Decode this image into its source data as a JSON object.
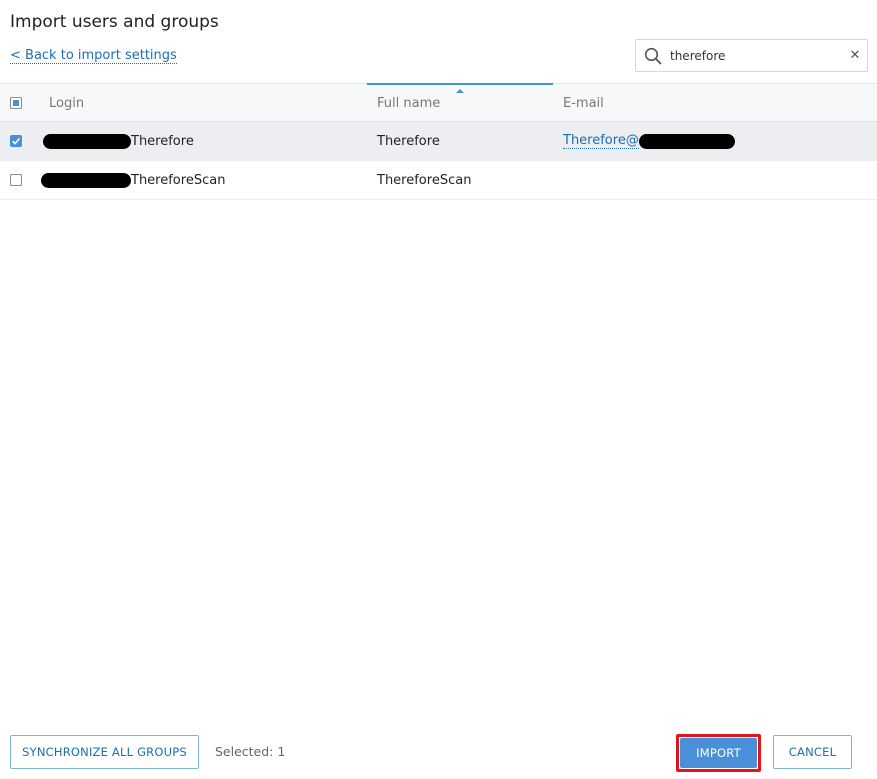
{
  "header": {
    "title": "Import users and groups",
    "back_link": "< Back to import settings"
  },
  "search": {
    "value": "therefore",
    "placeholder": ""
  },
  "table": {
    "columns": {
      "login": "Login",
      "full_name": "Full name",
      "email": "E-mail"
    },
    "sort_column": "Full name",
    "rows": [
      {
        "login_suffix": "Therefore",
        "full_name": "Therefore",
        "email_prefix": "Therefore@",
        "checked": true
      },
      {
        "login_suffix": "ThereforeScan",
        "full_name": "ThereforeScan",
        "email_prefix": "",
        "checked": false
      }
    ]
  },
  "footer": {
    "sync_label": "SYNCHRONIZE ALL GROUPS",
    "selected_label": "Selected: 1",
    "import_label": "IMPORT",
    "cancel_label": "CANCEL"
  },
  "colors": {
    "accent": "#4a90d9",
    "link": "#1a6fb5",
    "highlight": "#e0161f",
    "selected_row": "#eceef1"
  },
  "icons": {
    "search": "search-icon",
    "clear": "close-icon",
    "check": "check-icon"
  }
}
